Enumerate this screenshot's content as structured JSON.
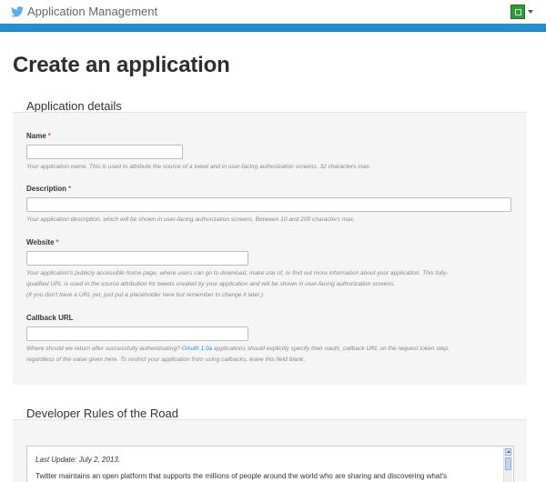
{
  "header": {
    "title": "Application Management",
    "logo_icon": "twitter-bird-icon",
    "avatar_icon": "user-avatar-icon",
    "accent_color": "#1f8fd4"
  },
  "page": {
    "title": "Create an application"
  },
  "details": {
    "heading": "Application details",
    "fields": [
      {
        "label": "Name",
        "required_mark": "*",
        "value": "",
        "help": "Your application name. This is used to attribute the source of a tweet and in user-facing authorization screens. 32 characters max."
      },
      {
        "label": "Description",
        "required_mark": "*",
        "value": "",
        "help": "Your application description, which will be shown in user-facing authorization screens. Between 10 and 200 characters max."
      },
      {
        "label": "Website",
        "required_mark": "*",
        "value": "",
        "help_line1": "Your application's publicly accessible home page, where users can go to download, make use of, or find out more information about your application. This fully-",
        "help_line2": "qualified URL is used in the source attribution for tweets created by your application and will be shown in user-facing authorization screens.",
        "help_line3": "(If you don't have a URL yet, just put a placeholder here but remember to change it later.)"
      },
      {
        "label": "Callback URL",
        "value": "",
        "help_pre": "Where should we return after successfully authenticating? ",
        "help_link": "OAuth 1.0a",
        "help_post": " applications should explicitly specify their oauth_callback URL on the request token step,",
        "help_line2": "regardless of the value given here. To restrict your application from using callbacks, leave this field blank."
      }
    ]
  },
  "rules": {
    "heading": "Developer Rules of the Road",
    "last_update": "Last Update: July 2, 2013.",
    "body": "Twitter maintains an open platform that supports the millions of people around the world who are sharing and discovering what's"
  }
}
